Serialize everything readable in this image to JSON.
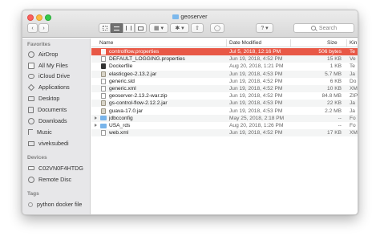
{
  "window": {
    "title": "geoserver"
  },
  "toolbar": {
    "back_label": "‹",
    "forward_label": "›",
    "view_icons": "icon-view-icon",
    "view_list": "list-view-icon",
    "view_columns": "column-view-icon",
    "view_gallery": "gallery-view-icon",
    "group_label": "▦ ▾",
    "action_label": "✱ ▾",
    "share_label": "⇧",
    "tag_label": "◯",
    "help_label": "? ▾",
    "search_placeholder": "Search"
  },
  "sidebar": {
    "favorites_heading": "Favorites",
    "favorites": [
      {
        "label": "AirDrop",
        "icon": "airdrop-icon"
      },
      {
        "label": "All My Files",
        "icon": "all-files-icon"
      },
      {
        "label": "iCloud Drive",
        "icon": "icloud-icon"
      },
      {
        "label": "Applications",
        "icon": "applications-icon"
      },
      {
        "label": "Desktop",
        "icon": "desktop-icon"
      },
      {
        "label": "Documents",
        "icon": "documents-icon"
      },
      {
        "label": "Downloads",
        "icon": "downloads-icon"
      },
      {
        "label": "Music",
        "icon": "music-icon"
      },
      {
        "label": "viveksubedi",
        "icon": "home-icon"
      }
    ],
    "devices_heading": "Devices",
    "devices": [
      {
        "label": "C02VN0F4HTDG",
        "icon": "hard-drive-icon"
      },
      {
        "label": "Remote Disc",
        "icon": "remote-disc-icon"
      }
    ],
    "tags_heading": "Tags",
    "tags": [
      {
        "label": "python docker file"
      }
    ]
  },
  "columns": {
    "name": "Name",
    "date": "Date Modified",
    "size": "Size",
    "kind": "Kin"
  },
  "files": [
    {
      "name": "controlflow.properties",
      "date": "Jul 5, 2018, 12:16 PM",
      "size": "506 bytes",
      "kind": "Te",
      "type": "doc"
    },
    {
      "name": "DEFAULT_LOGGING.properties",
      "date": "Jun 19, 2018, 4:52 PM",
      "size": "15 KB",
      "kind": "Ve",
      "type": "doc"
    },
    {
      "name": "Dockerfile",
      "date": "Aug 20, 2018, 1:21 PM",
      "size": "1 KB",
      "kind": "Te",
      "type": "exec"
    },
    {
      "name": "elasticgeo-2.13.2.jar",
      "date": "Jun 19, 2018, 4:53 PM",
      "size": "5.7 MB",
      "kind": "Ja",
      "type": "jar"
    },
    {
      "name": "generic.sld",
      "date": "Jun 19, 2018, 4:52 PM",
      "size": "6 KB",
      "kind": "Do",
      "type": "doc"
    },
    {
      "name": "generic.xml",
      "date": "Jun 19, 2018, 4:52 PM",
      "size": "10 KB",
      "kind": "XM",
      "type": "doc"
    },
    {
      "name": "geoserver-2.13.2-war.zip",
      "date": "Jun 19, 2018, 4:52 PM",
      "size": "84.8 MB",
      "kind": "ZIP",
      "type": "doc"
    },
    {
      "name": "gs-control-flow-2.12.2.jar",
      "date": "Jun 19, 2018, 4:53 PM",
      "size": "22 KB",
      "kind": "Ja",
      "type": "jar"
    },
    {
      "name": "guava-17.0.jar",
      "date": "Jun 19, 2018, 4:53 PM",
      "size": "2.2 MB",
      "kind": "Ja",
      "type": "jar"
    },
    {
      "name": "jdbcconfig",
      "date": "May 25, 2018, 2:18 PM",
      "size": "--",
      "kind": "Fo",
      "type": "folder"
    },
    {
      "name": "USA_rds",
      "date": "Aug 20, 2018, 1:26 PM",
      "size": "--",
      "kind": "Fo",
      "type": "folder"
    },
    {
      "name": "web.xml",
      "date": "Jun 19, 2018, 4:52 PM",
      "size": "17 KB",
      "kind": "XM",
      "type": "doc"
    }
  ]
}
